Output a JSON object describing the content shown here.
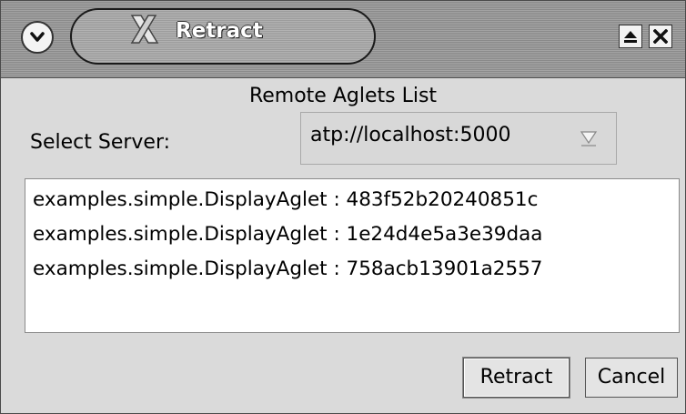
{
  "window": {
    "title": "Retract",
    "menu_icon": "chevron-down-circle-icon",
    "title_icon": "x-logo-icon",
    "shade_icon": "eject-icon",
    "close_icon": "close-icon"
  },
  "dialog": {
    "heading": "Remote Aglets List",
    "server_label": "Select Server:",
    "server_value": "atp://localhost:5000",
    "aglets": [
      "examples.simple.DisplayAglet : 483f52b20240851c",
      "examples.simple.DisplayAglet : 1e24d4e5a3e39daa",
      "examples.simple.DisplayAglet : 758acb13901a2557"
    ],
    "retract_label": "Retract",
    "cancel_label": "Cancel"
  }
}
